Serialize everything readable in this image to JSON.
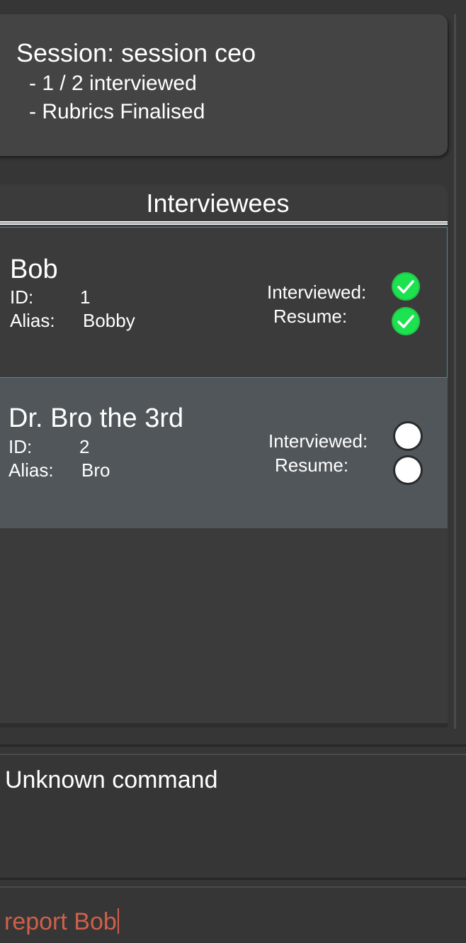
{
  "session": {
    "title": "Session: session ceo",
    "progress_line": "- 1 / 2 interviewed",
    "rubrics_line": "- Rubrics Finalised"
  },
  "list": {
    "header": "Interviewees",
    "id_label": "ID:",
    "alias_label": "Alias:",
    "interviewed_label": "Interviewed:",
    "resume_label": "Resume:",
    "items": [
      {
        "name": "Bob",
        "id": "1",
        "alias": "Bobby",
        "interviewed": true,
        "resume": true,
        "selected": true
      },
      {
        "name": "Dr. Bro the 3rd",
        "id": "2",
        "alias": "Bro",
        "interviewed": false,
        "resume": false,
        "selected": false
      }
    ]
  },
  "result": {
    "message": "Unknown command"
  },
  "command": {
    "value": "report Bob",
    "error_color": "#d0604a"
  },
  "colors": {
    "check_green": "#1de24f",
    "selected_border": "#3a8ea3"
  },
  "icons": {
    "done": "check-circle-icon",
    "pending": "empty-circle-icon"
  }
}
